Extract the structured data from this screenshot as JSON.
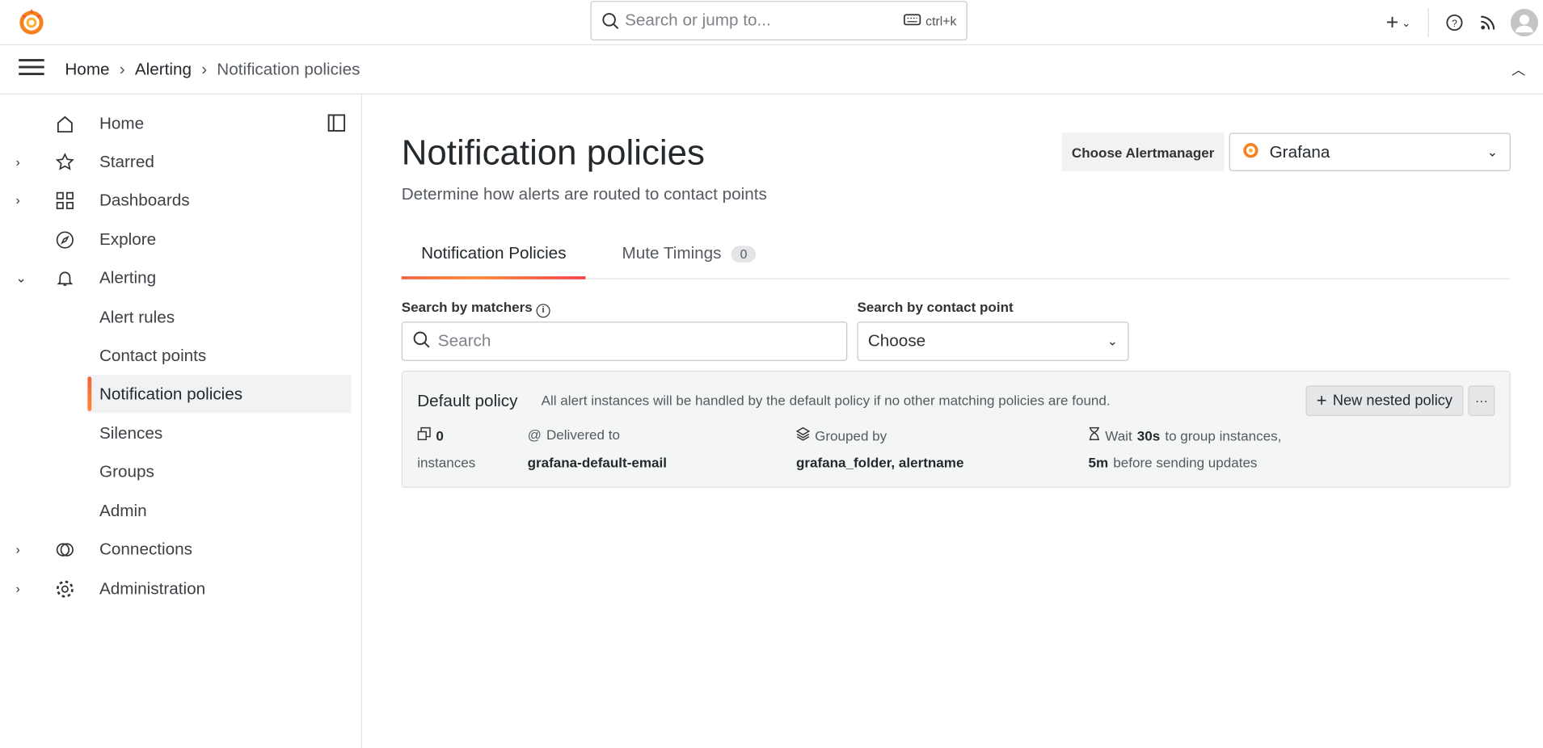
{
  "topbar": {
    "search_placeholder": "Search or jump to...",
    "shortcut": "ctrl+k"
  },
  "breadcrumb": [
    "Home",
    "Alerting",
    "Notification policies"
  ],
  "sidebar": {
    "items": [
      {
        "label": "Home",
        "icon": "home-icon"
      },
      {
        "label": "Starred",
        "icon": "star-icon"
      },
      {
        "label": "Dashboards",
        "icon": "dashboards-icon"
      },
      {
        "label": "Explore",
        "icon": "compass-icon"
      },
      {
        "label": "Alerting",
        "icon": "bell-icon"
      },
      {
        "label": "Alert rules"
      },
      {
        "label": "Contact points"
      },
      {
        "label": "Notification policies"
      },
      {
        "label": "Silences"
      },
      {
        "label": "Groups"
      },
      {
        "label": "Admin"
      },
      {
        "label": "Connections",
        "icon": "connections-icon"
      },
      {
        "label": "Administration",
        "icon": "gear-icon"
      }
    ]
  },
  "page": {
    "title": "Notification policies",
    "subtitle": "Determine how alerts are routed to contact points",
    "alertmanager_label": "Choose Alertmanager",
    "alertmanager_value": "Grafana",
    "tabs": [
      {
        "label": "Notification Policies"
      },
      {
        "label": "Mute Timings",
        "count": "0"
      }
    ],
    "filters": {
      "matchers_label": "Search by matchers",
      "matchers_placeholder": "Search",
      "contact_label": "Search by contact point",
      "contact_placeholder": "Choose"
    },
    "policy": {
      "title": "Default policy",
      "description": "All alert instances will be handled by the default policy if no other matching policies are found.",
      "new_button": "New nested policy",
      "more": "···",
      "instances_count": "0",
      "instances_label": "instances",
      "delivered_label": "Delivered to",
      "delivered_value": "grafana-default-email",
      "grouped_label": "Grouped by",
      "grouped_value": "grafana_folder, alertname",
      "wait_prefix": "Wait",
      "wait_value": "30s",
      "wait_suffix": "to group instances,",
      "repeat_value": "5m",
      "repeat_suffix": "before sending updates"
    }
  }
}
